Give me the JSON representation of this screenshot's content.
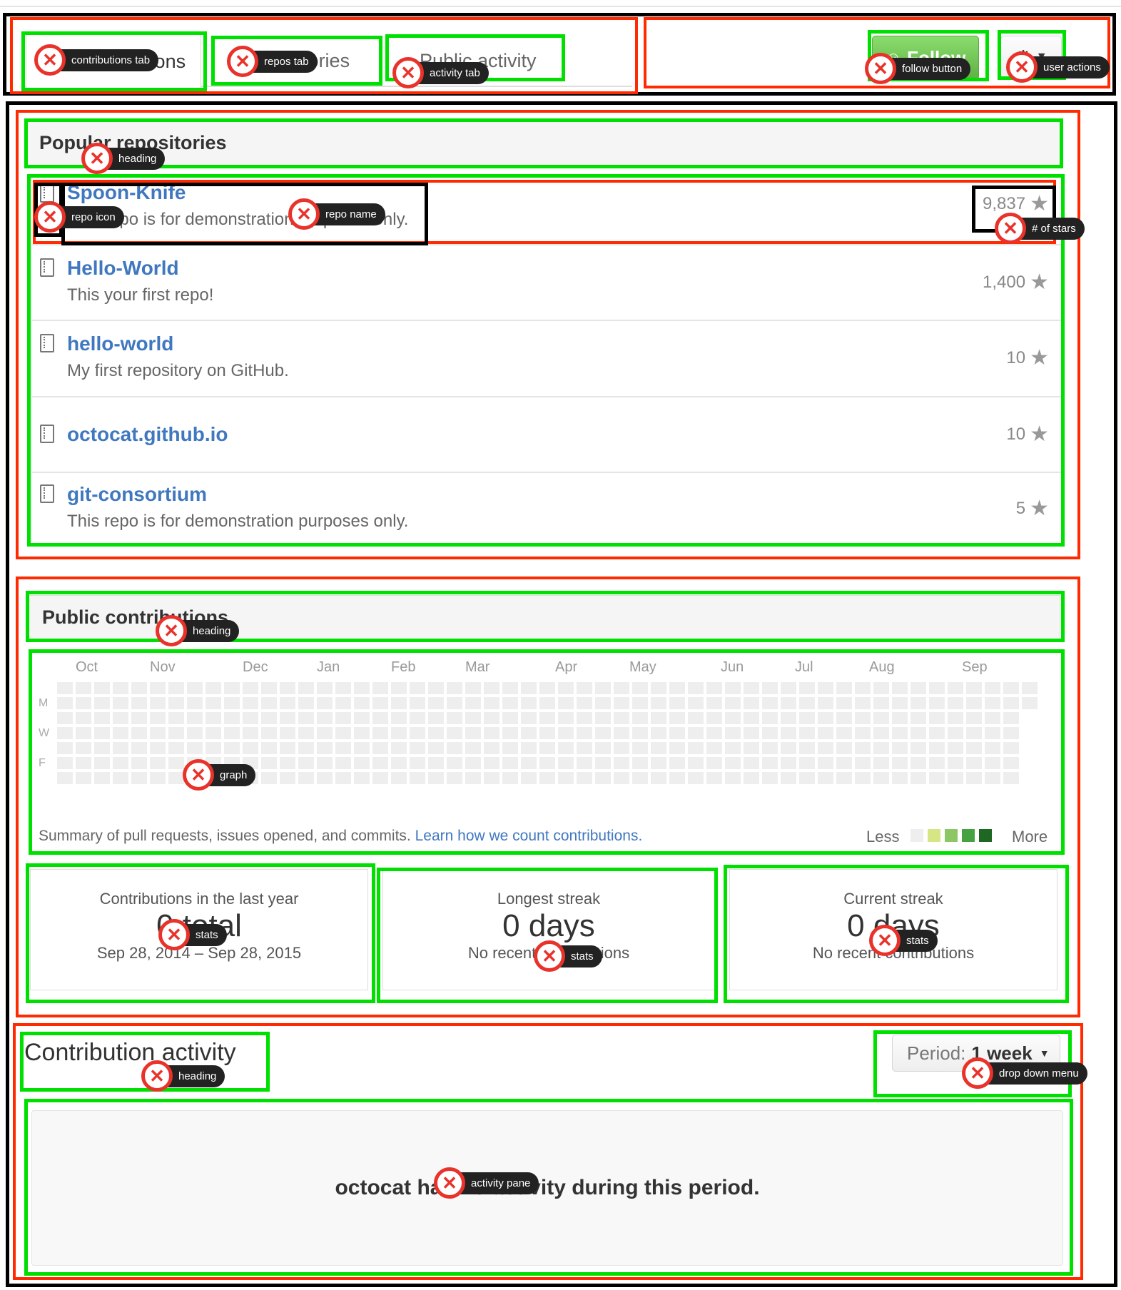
{
  "tabs": {
    "contributions_label": "Contributions",
    "repos_label": "Repositories",
    "activity_label": "Public activity"
  },
  "header_actions": {
    "follow_label": "Follow",
    "user_actions_icon": "gear-icon"
  },
  "popular_repos": {
    "heading": "Popular repositories",
    "items": [
      {
        "name": "Spoon-Knife",
        "description": "This repo is for demonstration purposes only.",
        "stars": "9,837"
      },
      {
        "name": "Hello-World",
        "description": "This your first repo!",
        "stars": "1,400"
      },
      {
        "name": "hello-world",
        "description": "My first repository on GitHub.",
        "stars": "10"
      },
      {
        "name": "octocat.github.io",
        "description": "",
        "stars": "10"
      },
      {
        "name": "git-consortium",
        "description": "This repo is for demonstration purposes only.",
        "stars": "5"
      }
    ]
  },
  "contributions": {
    "heading": "Public contributions",
    "months": [
      "Oct",
      "Nov",
      "Dec",
      "Jan",
      "Feb",
      "Mar",
      "Apr",
      "May",
      "Jun",
      "Jul",
      "Aug",
      "Sep"
    ],
    "days": [
      "M",
      "W",
      "F"
    ],
    "summary": "Summary of pull requests, issues opened, and commits.",
    "learn_link": "Learn how we count contributions.",
    "legend_less": "Less",
    "legend_more": "More",
    "legend_colors": [
      "#eeeeee",
      "#d6e685",
      "#8cc665",
      "#44a340",
      "#1e6823"
    ],
    "stats": [
      {
        "label": "Contributions in the last year",
        "value": "0 total",
        "range": "Sep 28, 2014 – Sep 28, 2015"
      },
      {
        "label": "Longest streak",
        "value": "0 days",
        "range": "No recent contributions"
      },
      {
        "label": "Current streak",
        "value": "0 days",
        "range": "No recent contributions"
      }
    ]
  },
  "activity": {
    "heading": "Contribution activity",
    "period_label": "Period:",
    "period_value": "1 week",
    "empty_message": "octocat has no activity during this period."
  },
  "annotations": {
    "contributions_tab": "contributions tab",
    "repos_tab": "repos tab",
    "activity_tab": "activity tab",
    "follow_button": "follow button",
    "user_actions": "user actions",
    "repos_heading": "heading",
    "repo_icon": "repo icon",
    "repo_name": "repo name",
    "num_stars": "# of stars",
    "contrib_heading": "heading",
    "graph": "graph",
    "stats_1": "stats",
    "stats_2": "stats",
    "stats_3": "stats",
    "activity_heading": "heading",
    "drop_down_menu": "drop down menu",
    "activity_pane": "activity pane"
  }
}
